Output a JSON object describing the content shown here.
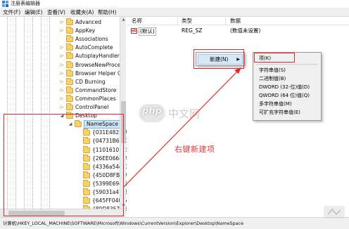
{
  "window": {
    "title": "注册表编辑器"
  },
  "menubar": {
    "items": [
      "文件(F)",
      "编辑(E)",
      "查看(V)",
      "收藏夹(A)",
      "帮助(H)"
    ]
  },
  "tree": {
    "items": [
      {
        "label": "Advanced",
        "expand": "▷"
      },
      {
        "label": "AppKey",
        "expand": "▷"
      },
      {
        "label": "Associations",
        "expand": ""
      },
      {
        "label": "AutoComplete",
        "expand": "▷"
      },
      {
        "label": "AutoplayHandlers",
        "expand": "▷"
      },
      {
        "label": "BrowseNewProces",
        "expand": "▷"
      },
      {
        "label": "Browser Helper Ol",
        "expand": "▷"
      },
      {
        "label": "CD Burning",
        "expand": "▷"
      },
      {
        "label": "CommandStore",
        "expand": "▷"
      },
      {
        "label": "CommonPlaces",
        "expand": "▷"
      },
      {
        "label": "ControlPanel",
        "expand": "▷"
      },
      {
        "label": "Desktop",
        "expand": "◢"
      },
      {
        "label": "NameSpace",
        "expand": "◢",
        "selected": true
      },
      {
        "label": "{031E4825-7",
        "expand": ""
      },
      {
        "label": "{04731B67-D",
        "expand": ""
      },
      {
        "label": "{11016101-E",
        "expand": ""
      },
      {
        "label": "{26EE0668-A",
        "expand": ""
      },
      {
        "label": "{4336a54d-0",
        "expand": ""
      },
      {
        "label": "{450D8FBA-A",
        "expand": ""
      },
      {
        "label": "{5399E694-6",
        "expand": ""
      },
      {
        "label": "{59031a47-3",
        "expand": ""
      },
      {
        "label": "{645FF040-5",
        "expand": ""
      },
      {
        "label": "{89D83576-6",
        "expand": ""
      },
      {
        "label": "{8FD8B88D-",
        "expand": ""
      }
    ]
  },
  "values": {
    "headers": [
      "名称",
      "类型",
      "数据"
    ],
    "rows": [
      {
        "icon": "ab",
        "name": "(默认)",
        "type": "REG_SZ",
        "data": "(数值未设置)"
      }
    ]
  },
  "context_menu": {
    "new_label": "新建(N)",
    "submenu": {
      "key": "项(K)",
      "items": [
        "字符串值(S)",
        "二进制值(B)",
        "DWORD (32-位)值(D)",
        "QWORD (64 位)值(Q)",
        "多字符串值(M)",
        "可扩充字符串值(E)"
      ]
    }
  },
  "annotation": {
    "text": "右键新建项",
    "color": "#e8262a"
  },
  "statusbar": {
    "path": "计算机\\HKEY_LOCAL_MACHINE\\SOFTWARE\\Microsoft\\Windows\\CurrentVersion\\Explorer\\Desktop\\NameSpace"
  },
  "watermark": {
    "logo": "php",
    "text": "中文网"
  },
  "icons": {
    "app": "registry-editor-icon",
    "folder": "folder-icon",
    "value": "string-value-icon"
  }
}
